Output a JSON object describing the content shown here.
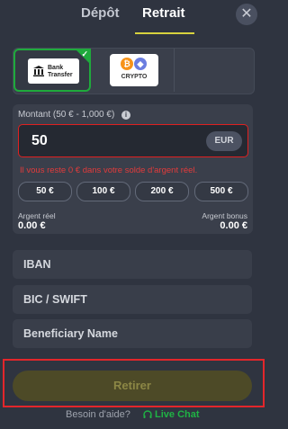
{
  "tabs": {
    "deposit": "Dépôt",
    "withdraw": "Retrait",
    "close_icon": "close-icon"
  },
  "methods": {
    "bank": {
      "label": "Bank Transfer",
      "selected": true
    },
    "crypto": {
      "label": "CRYPTO"
    }
  },
  "amount": {
    "label": "Montant (50 € - 1,000 €)",
    "value": "50",
    "currency": "EUR",
    "error": "Il vous reste 0 € dans votre solde d'argent réel.",
    "presets": [
      "50 €",
      "100 €",
      "200 €",
      "500 €"
    ]
  },
  "balances": {
    "real_label": "Argent réel",
    "real_value": "0.00 €",
    "bonus_label": "Argent bonus",
    "bonus_value": "0.00 €"
  },
  "fields": {
    "iban": "IBAN",
    "bic": "BIC / SWIFT",
    "beneficiary": "Beneficiary Name"
  },
  "submit": {
    "label": "Retirer"
  },
  "help": {
    "text": "Besoin d'aide?",
    "link": "Live Chat"
  },
  "colors": {
    "accent": "#d7d23e",
    "selected": "#1faa3c",
    "error": "#e02020",
    "chat": "#1fb344"
  }
}
